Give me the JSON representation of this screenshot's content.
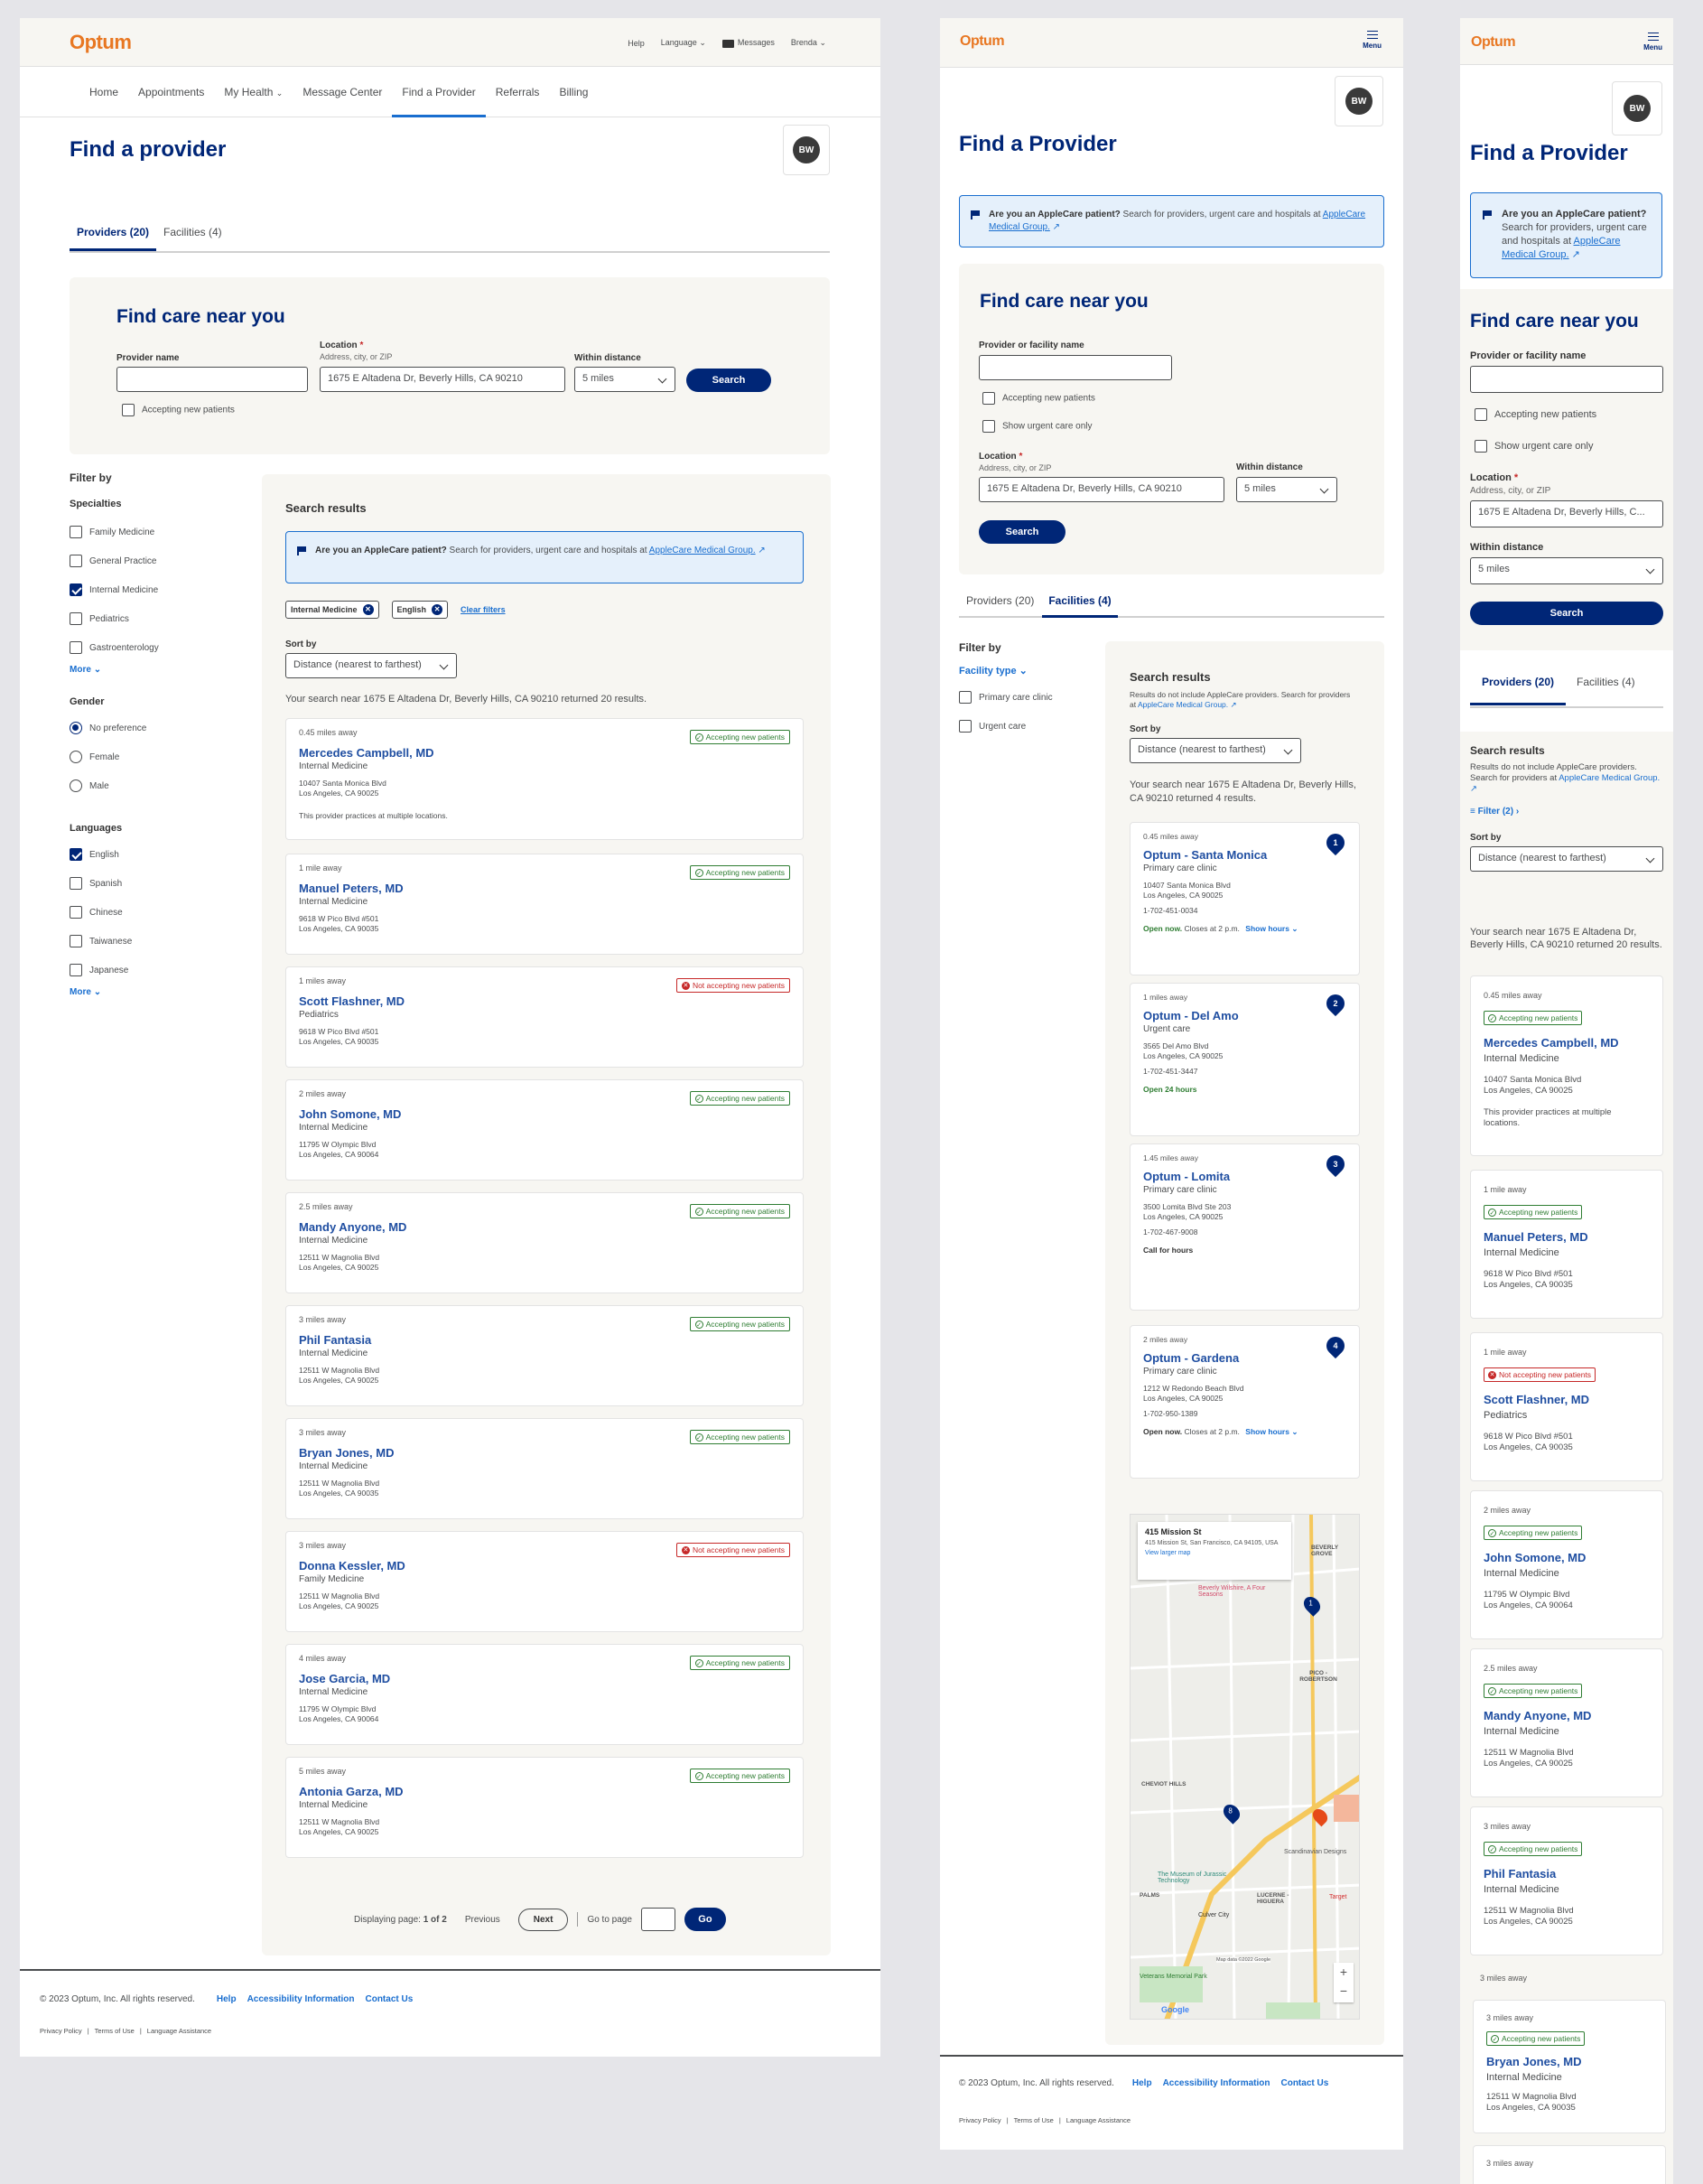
{
  "brand": "Optum",
  "desktop": {
    "util": {
      "help": "Help",
      "language": "Language",
      "messages": "Messages",
      "user": "Brenda"
    },
    "nav": [
      "Home",
      "Appointments",
      "My Health",
      "Message Center",
      "Find a Provider",
      "Referrals",
      "Billing"
    ],
    "title": "Find a provider",
    "avatar": "BW",
    "tabs": [
      "Providers (20)",
      "Facilities (4)"
    ],
    "search": {
      "title": "Find care near you",
      "name_label": "Provider name",
      "loc_label": "Location",
      "loc_hint": "Address, city, or ZIP",
      "loc_value": "1675 E Altadena Dr, Beverly Hills, CA 90210",
      "dist_label": "Within distance",
      "dist_value": "5 miles",
      "button": "Search",
      "accepting": "Accepting new patients"
    },
    "filter": {
      "title": "Filter by",
      "spec_title": "Specialties",
      "specialties": [
        "Family Medicine",
        "General Practice",
        "Internal Medicine",
        "Pediatrics",
        "Gastroenterology"
      ],
      "more": "More",
      "gender_title": "Gender",
      "genders": [
        "No preference",
        "Female",
        "Male"
      ],
      "lang_title": "Languages",
      "languages": [
        "English",
        "Spanish",
        "Chinese",
        "Taiwanese",
        "Japanese"
      ],
      "more2": "More"
    },
    "results": {
      "title": "Search results",
      "banner_bold": "Are you an AppleCare patient?",
      "banner_text": " Search for providers, urgent care and hospitals at ",
      "banner_link": "AppleCare Medical Group.",
      "chips": [
        "Internal Medicine",
        "English"
      ],
      "clear": "Clear filters",
      "sort_label": "Sort by",
      "sort_value": "Distance (nearest to farthest)",
      "summary": "Your search near 1675 E Altadena Dr, Beverly Hills, CA 90210 returned 20 results."
    },
    "providers": [
      {
        "dist": "0.45 miles away",
        "name": "Mercedes Campbell, MD",
        "spec": "Internal Medicine",
        "a1": "10407 Santa Monica Blvd",
        "a2": "Los Angeles, CA 90025",
        "note": "This provider practices at multiple locations.",
        "status": "Accepting new patients",
        "ok": true
      },
      {
        "dist": "1 mile away",
        "name": "Manuel Peters, MD",
        "spec": "Internal Medicine",
        "a1": "9618 W Pico Blvd #501",
        "a2": "Los Angeles, CA 90035",
        "note": "",
        "status": "Accepting new patients",
        "ok": true
      },
      {
        "dist": "1 miles away",
        "name": "Scott Flashner, MD",
        "spec": "Pediatrics",
        "a1": "9618 W Pico Blvd #501",
        "a2": "Los Angeles, CA 90035",
        "note": "",
        "status": "Not accepting new patients",
        "ok": false
      },
      {
        "dist": "2 miles away",
        "name": "John Somone, MD",
        "spec": "Internal Medicine",
        "a1": "11795 W Olympic Blvd",
        "a2": "Los Angeles, CA 90064",
        "note": "",
        "status": "Accepting new patients",
        "ok": true
      },
      {
        "dist": "2.5 miles away",
        "name": "Mandy Anyone, MD",
        "spec": "Internal Medicine",
        "a1": "12511 W Magnolia Blvd",
        "a2": "Los Angeles, CA 90025",
        "note": "",
        "status": "Accepting new patients",
        "ok": true
      },
      {
        "dist": "3 miles away",
        "name": "Phil Fantasia",
        "spec": "Internal Medicine",
        "a1": "12511 W Magnolia Blvd",
        "a2": "Los Angeles, CA 90025",
        "note": "",
        "status": "Accepting new patients",
        "ok": true
      },
      {
        "dist": "3 miles away",
        "name": "Bryan Jones, MD",
        "spec": "Internal Medicine",
        "a1": "12511 W Magnolia Blvd",
        "a2": "Los Angeles, CA 90035",
        "note": "",
        "status": "Accepting new patients",
        "ok": true
      },
      {
        "dist": "3 miles away",
        "name": "Donna Kessler, MD",
        "spec": "Family Medicine",
        "a1": "12511 W Magnolia Blvd",
        "a2": "Los Angeles, CA 90025",
        "note": "",
        "status": "Not accepting new patients",
        "ok": false
      },
      {
        "dist": "4 miles away",
        "name": "Jose Garcia, MD",
        "spec": "Internal Medicine",
        "a1": "11795 W Olympic Blvd",
        "a2": "Los Angeles, CA 90064",
        "note": "",
        "status": "Accepting new patients",
        "ok": true
      },
      {
        "dist": "5 miles away",
        "name": "Antonia Garza, MD",
        "spec": "Internal Medicine",
        "a1": "12511 W Magnolia Blvd",
        "a2": "Los Angeles, CA 90025",
        "note": "",
        "status": "Accepting new patients",
        "ok": true
      }
    ],
    "pager": {
      "displaying": "Displaying page: ",
      "page": "1 of 2",
      "prev": "Previous",
      "next": "Next",
      "goto": "Go to page",
      "go": "Go"
    },
    "footer": {
      "copy": "© 2023 Optum, Inc. All rights reserved.",
      "help": "Help",
      "access": "Accessibility Information",
      "contact": "Contact Us",
      "privacy": "Privacy Policy",
      "terms": "Terms of Use",
      "lang": "Language Assistance"
    }
  },
  "tablet": {
    "menu": "Menu",
    "avatar": "BW",
    "title": "Find a Provider",
    "banner_bold": "Are you an AppleCare patient?",
    "banner_text": " Search for providers, urgent care and hospitals at ",
    "banner_link": "AppleCare Medical Group.",
    "search": {
      "title": "Find care near you",
      "name_label": "Provider or facility name",
      "accepting": "Accepting new patients",
      "urgent": "Show urgent care only",
      "loc_label": "Location",
      "loc_hint": "Address, city, or ZIP",
      "loc_value": "1675 E Altadena Dr, Beverly Hills, CA 90210",
      "dist_label": "Within distance",
      "dist_value": "5 miles",
      "button": "Search"
    },
    "tabs": [
      "Providers (20)",
      "Facilities (4)"
    ],
    "filter": {
      "title": "Filter by",
      "type": "Facility type",
      "options": [
        "Primary care clinic",
        "Urgent care"
      ]
    },
    "results": {
      "title": "Search results",
      "note": "Results do not include AppleCare providers. Search for providers at ",
      "note_link": "AppleCare Medical Group.",
      "sort_label": "Sort by",
      "sort_value": "Distance (nearest to farthest)",
      "summary": "Your search near 1675 E Altadena Dr, Beverly Hills, CA 90210 returned 4 results."
    },
    "facilities": [
      {
        "dist": "0.45 miles away",
        "name": "Optum - Santa Monica",
        "type": "Primary care clinic",
        "a1": "10407 Santa Monica Blvd",
        "a2": "Los Angeles, CA 90025",
        "phone": "1-702-451-0034",
        "open": "Open now.",
        "hours": " Closes at 2 p.m.",
        "show": "Show hours",
        "pin": "1"
      },
      {
        "dist": "1 miles away",
        "name": "Optum - Del Amo",
        "type": "Urgent care",
        "a1": "3565 Del Amo Blvd",
        "a2": "Los Angeles, CA 90025",
        "phone": "1-702-451-3447",
        "open": "Open 24 hours",
        "hours": "",
        "show": "",
        "pin": "2"
      },
      {
        "dist": "1.45 miles away",
        "name": "Optum - Lomita",
        "type": "Primary care clinic",
        "a1": "3500 Lomita Blvd Ste 203",
        "a2": "Los Angeles, CA 90025",
        "phone": "1-702-467-9008",
        "open": "Call for hours",
        "hours": "",
        "show": "",
        "pin": "3"
      },
      {
        "dist": "2 miles away",
        "name": "Optum - Gardena",
        "type": "Primary care clinic",
        "a1": "1212 W Redondo Beach Blvd",
        "a2": "Los Angeles, CA 90025",
        "phone": "1-702-950-1389",
        "open": "Open now.",
        "hours": " Closes at 2 p.m.",
        "show": "Show hours",
        "pin": "4"
      }
    ],
    "map": {
      "place": "415 Mission St",
      "addr": "415 Mission St, San Francisco, CA 94105, USA",
      "larger": "View larger map",
      "labels": [
        "BEVERLY GROVE",
        "PICO - ROBERTSON",
        "CHEVIOT HILLS",
        "PALMS",
        "Culver City",
        "LUCERNE - HIGUERA",
        "Beverly Wilshire, A Four Seasons",
        "The Museum of Jurassic Technology",
        "Scandinavian Designs",
        "Target",
        "Veterans Memorial Park",
        "Google",
        "Map data ©2022 Google"
      ],
      "pin": "8"
    },
    "footer": {
      "copy": "© 2023 Optum, Inc. All rights reserved.",
      "help": "Help",
      "access": "Accessibility Information",
      "contact": "Contact Us",
      "privacy": "Privacy Policy",
      "terms": "Terms of Use",
      "lang": "Language Assistance"
    }
  },
  "mobile": {
    "menu": "Menu",
    "avatar": "BW",
    "title": "Find a Provider",
    "banner_bold": "Are you an AppleCare patient?",
    "banner_text": " Search for providers, urgent care and hospitals at ",
    "banner_link": "AppleCare Medical Group.",
    "search": {
      "title": "Find care near you",
      "name_label": "Provider or facility name",
      "accepting": "Accepting new patients",
      "urgent": "Show urgent care only",
      "loc_label": "Location",
      "loc_hint": "Address, city, or ZIP",
      "loc_value": "1675 E Altadena Dr, Beverly Hills, C...",
      "dist_label": "Within distance",
      "dist_value": "5 miles",
      "button": "Search"
    },
    "tabs": [
      "Providers (20)",
      "Facilities (4)"
    ],
    "results": {
      "title": "Search results",
      "note": "Results do not include AppleCare providers. Search for providers at ",
      "note_link": "AppleCare Medical Group.",
      "filter": "Filter (2)",
      "sort_label": "Sort by",
      "sort_value": "Distance (nearest to farthest)",
      "summary": "Your search near 1675 E Altadena Dr, Beverly Hills, CA 90210 returned 20 results."
    },
    "providers": [
      {
        "dist": "0.45 miles away",
        "status": "Accepting new patients",
        "ok": true,
        "name": "Mercedes Campbell, MD",
        "spec": "Internal Medicine",
        "a1": "10407 Santa Monica Blvd",
        "a2": "Los Angeles, CA 90025",
        "note": "This provider practices at multiple locations."
      },
      {
        "dist": "1 mile away",
        "status": "Accepting new patients",
        "ok": true,
        "name": "Manuel Peters, MD",
        "spec": "Internal Medicine",
        "a1": "9618 W Pico Blvd #501",
        "a2": "Los Angeles, CA 90035",
        "note": ""
      },
      {
        "dist": "1 mile away",
        "status": "Not accepting new patients",
        "ok": false,
        "name": "Scott Flashner, MD",
        "spec": "Pediatrics",
        "a1": "9618 W Pico Blvd #501",
        "a2": "Los Angeles, CA 90035",
        "note": ""
      },
      {
        "dist": "2 miles away",
        "status": "Accepting new patients",
        "ok": true,
        "name": "John Somone, MD",
        "spec": "Internal Medicine",
        "a1": "11795 W Olympic Blvd",
        "a2": "Los Angeles, CA 90064",
        "note": ""
      },
      {
        "dist": "2.5 miles away",
        "status": "Accepting new patients",
        "ok": true,
        "name": "Mandy Anyone, MD",
        "spec": "Internal Medicine",
        "a1": "12511 W Magnolia Blvd",
        "a2": "Los Angeles, CA 90025",
        "note": ""
      },
      {
        "dist": "3 miles away",
        "status": "Accepting new patients",
        "ok": true,
        "name": "Phil Fantasia",
        "spec": "Internal Medicine",
        "a1": "12511 W Magnolia Blvd",
        "a2": "Los Angeles, CA 90025",
        "note": ""
      },
      {
        "dist": "3 miles away",
        "status": "Accepting new patients",
        "ok": true,
        "name": "Bryan Jones, MD",
        "spec": "Internal Medicine",
        "a1": "12511 W Magnolia Blvd",
        "a2": "Los Angeles, CA 90035",
        "note": ""
      }
    ],
    "stub_dist": "3 miles away",
    "stub2_dist": "3 miles away"
  },
  "colors": {
    "brand": "#e87722",
    "navy": "#002677",
    "link": "#196ecf",
    "ok": "#2e7d32",
    "no": "#c62828",
    "bg": "#e5e5e9",
    "beige": "#f7f6f2"
  }
}
